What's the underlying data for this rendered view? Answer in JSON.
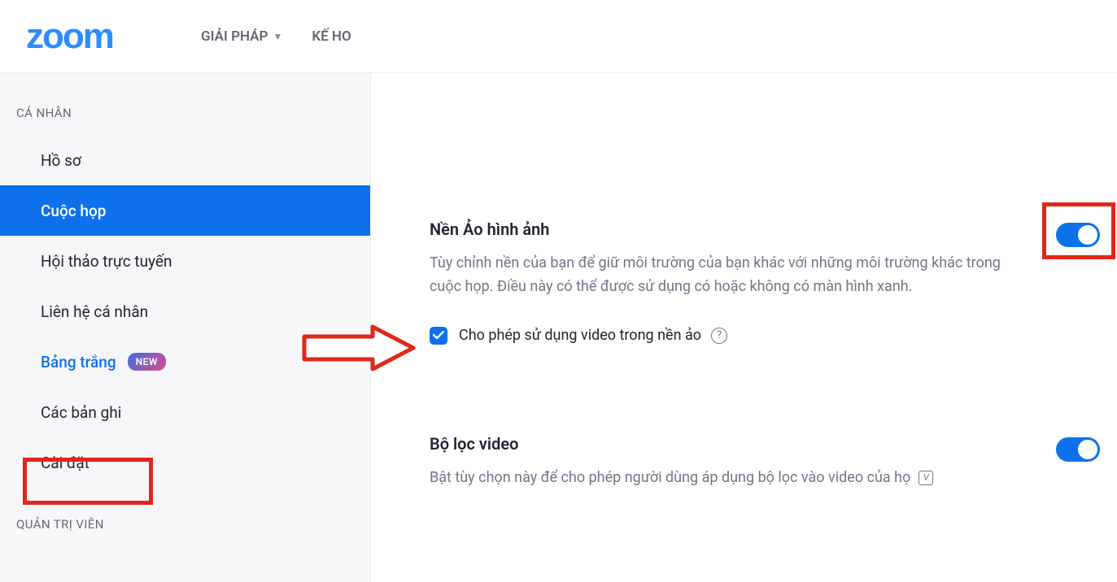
{
  "header": {
    "logo_text": "zoom",
    "nav": {
      "solutions": "GIẢI PHÁP",
      "plans_partial": "KẾ HO"
    }
  },
  "sidebar": {
    "section_personal": "CÁ NHÂN",
    "section_admin": "QUẢN TRỊ VIÊN",
    "items": {
      "profile": "Hồ sơ",
      "meetings": "Cuộc họp",
      "webinars": "Hội thảo trực tuyến",
      "contacts": "Liên hệ cá nhân",
      "whiteboard": "Bảng trắng",
      "whiteboard_badge": "NEW",
      "recordings": "Các bản ghi",
      "settings": "Cài đặt"
    }
  },
  "settings": {
    "virtual_bg": {
      "title": "Nền Ảo hình ảnh",
      "desc": "Tùy chỉnh nền của bạn để giữ môi trường của bạn khác với những môi trường khác trong cuộc họp. Điều này có thể được sử dụng có hoặc không có màn hình xanh.",
      "allow_video": "Cho phép sử dụng video trong nền ảo",
      "toggle_on": true,
      "checkbox_on": true
    },
    "video_filter": {
      "title": "Bộ lọc video",
      "desc": "Bật tùy chọn này để cho phép người dùng áp dụng bộ lọc vào video của họ",
      "toggle_on": true
    }
  }
}
